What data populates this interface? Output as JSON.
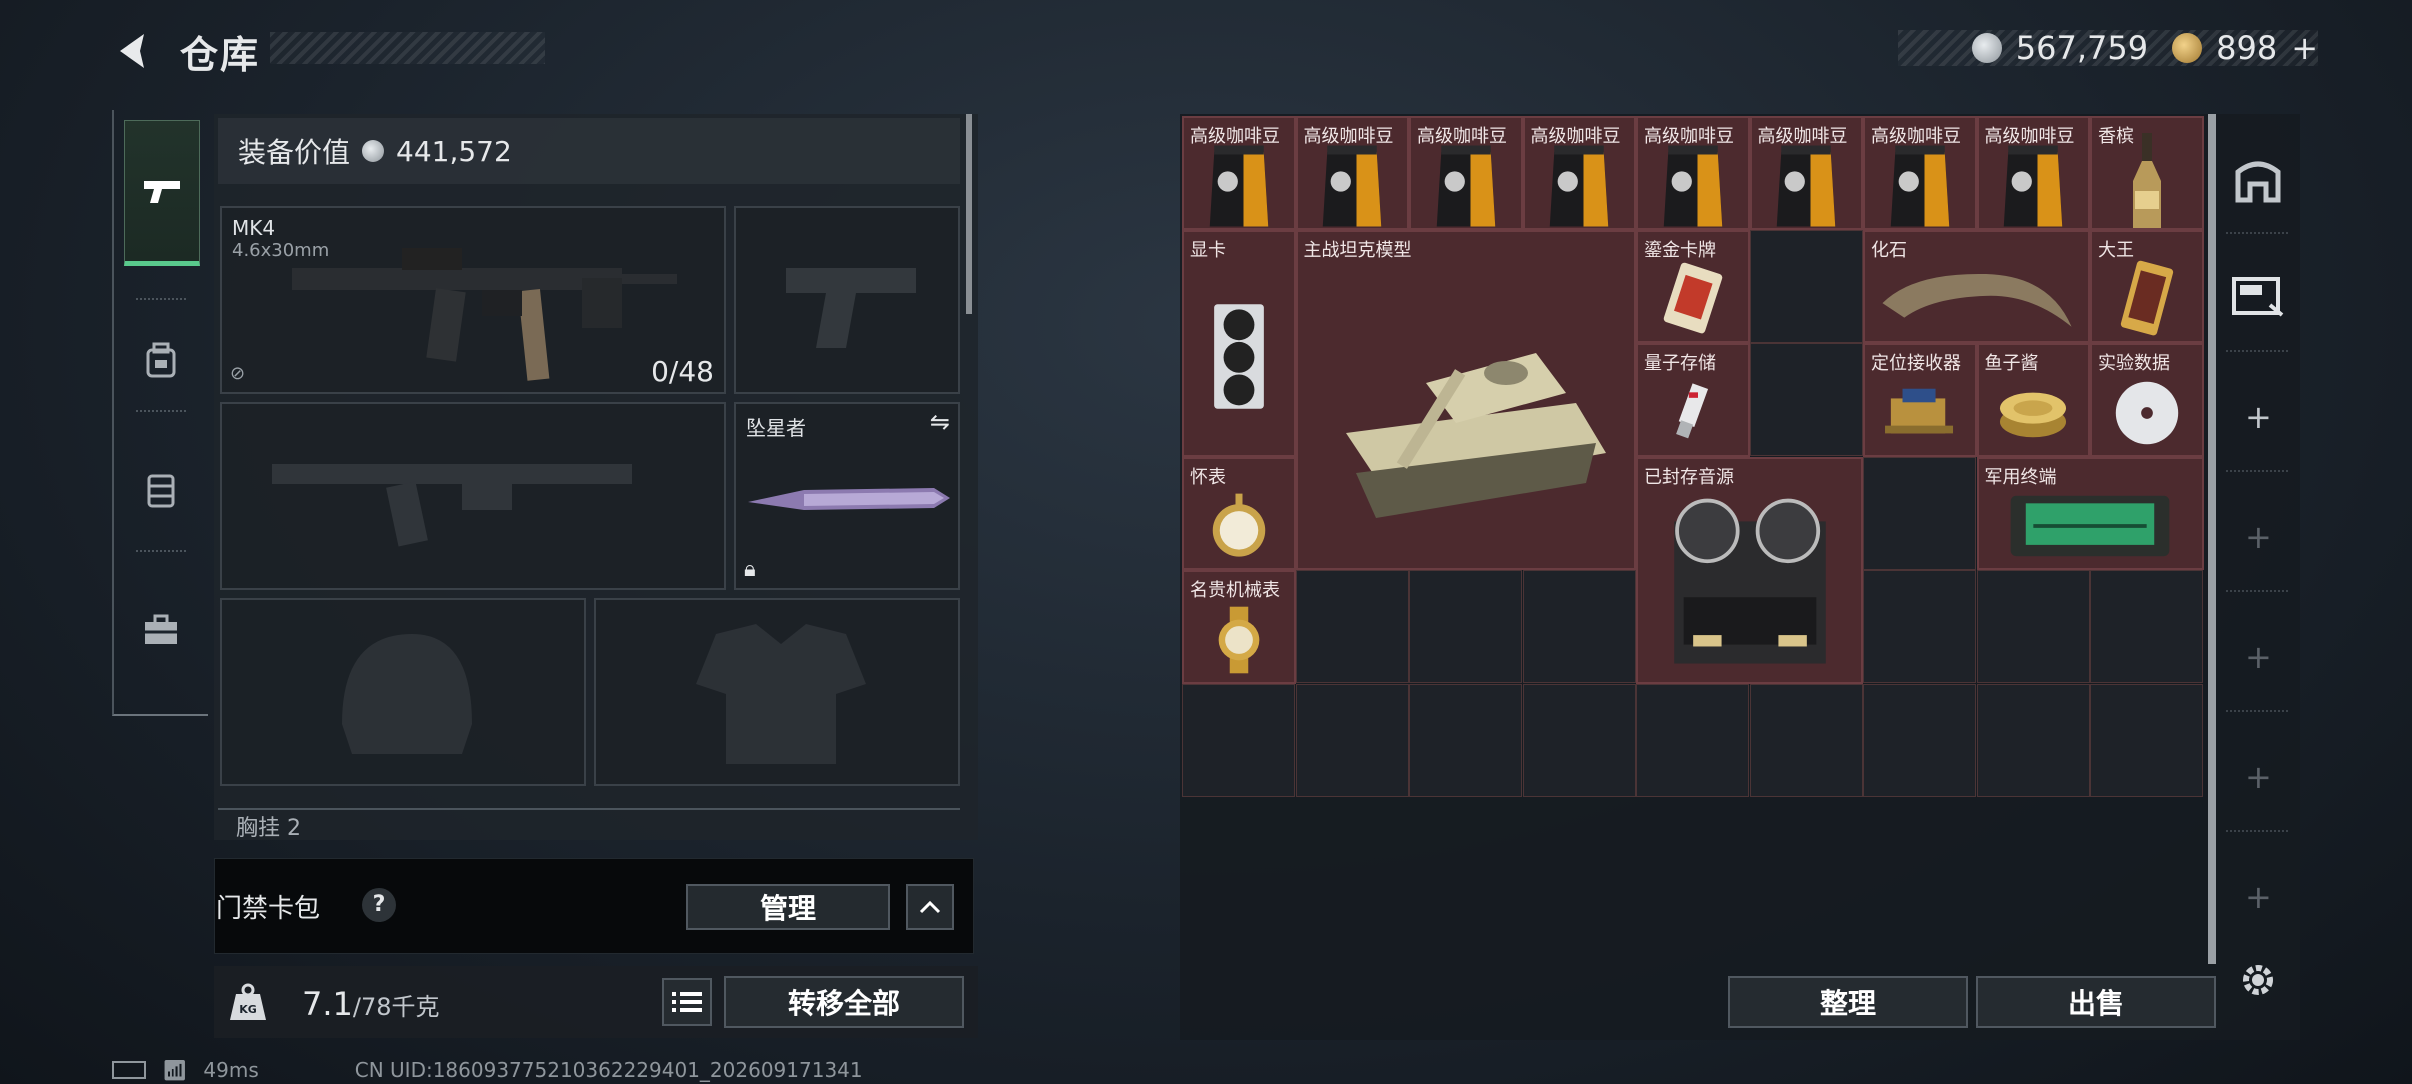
{
  "header": {
    "title": "仓库",
    "back_icon": "back-arrow-icon"
  },
  "currency": {
    "silver": "567,759",
    "gold": "898",
    "gold_plus": "+",
    "silver_color": "#b9bec4",
    "gold_color": "#c9a14a"
  },
  "tabs": [
    {
      "icon": "pistol-icon",
      "active": true
    },
    {
      "icon": "backpack-icon",
      "active": false
    },
    {
      "icon": "vest-icon",
      "active": false
    },
    {
      "icon": "toolbox-icon",
      "active": false
    }
  ],
  "equipment": {
    "value_label": "装备价值",
    "value": "441,572",
    "primary": {
      "name": "MK4",
      "ammo_type": "4.6x30mm",
      "ammo": "0/48"
    },
    "melee": {
      "name": "坠星者"
    },
    "chest_label": "胸挂 2",
    "keycard_label": "门禁卡包",
    "keycard_help": "?",
    "manage_label": "管理",
    "weight": "7.1",
    "weight_max": "/78千克",
    "transfer_all_label": "转移全部"
  },
  "storage": {
    "items": [
      {
        "name": "高级咖啡豆",
        "icon": "coffee-bag-icon"
      },
      {
        "name": "高级咖啡豆",
        "icon": "coffee-bag-icon"
      },
      {
        "name": "高级咖啡豆",
        "icon": "coffee-bag-icon"
      },
      {
        "name": "高级咖啡豆",
        "icon": "coffee-bag-icon"
      },
      {
        "name": "高级咖啡豆",
        "icon": "coffee-bag-icon"
      },
      {
        "name": "高级咖啡豆",
        "icon": "coffee-bag-icon"
      },
      {
        "name": "高级咖啡豆",
        "icon": "coffee-bag-icon"
      },
      {
        "name": "高级咖啡豆",
        "icon": "coffee-bag-icon"
      },
      {
        "name": "香槟",
        "icon": "champagne-icon"
      },
      {
        "name": "显卡",
        "icon": "graphics-card-icon"
      },
      {
        "name": "主战坦克模型",
        "icon": "tank-model-icon"
      },
      {
        "name": "鎏金卡牌",
        "icon": "gold-card-icon"
      },
      {
        "name": "化石",
        "icon": "fossil-claw-icon"
      },
      {
        "name": "大王",
        "icon": "king-card-icon"
      },
      {
        "name": "量子存储",
        "icon": "usb-drive-icon"
      },
      {
        "name": "定位接收器",
        "icon": "receiver-icon"
      },
      {
        "name": "鱼子酱",
        "icon": "caviar-tin-icon"
      },
      {
        "name": "实验数据",
        "icon": "data-disc-icon"
      },
      {
        "name": "怀表",
        "icon": "pocket-watch-icon"
      },
      {
        "name": "已封存音源",
        "icon": "reel-recorder-icon"
      },
      {
        "name": "军用终端",
        "icon": "military-terminal-icon"
      },
      {
        "name": "名贵机械表",
        "icon": "wristwatch-icon"
      }
    ],
    "sort_label": "整理",
    "sell_label": "出售"
  },
  "side": {
    "icons": [
      "safe-box-icon",
      "card-pack-icon",
      "plus-icon",
      "settings-gear-icon"
    ]
  },
  "status": {
    "ping": "49ms",
    "uid": "CN UID:186093775210362229401_202609171341"
  }
}
